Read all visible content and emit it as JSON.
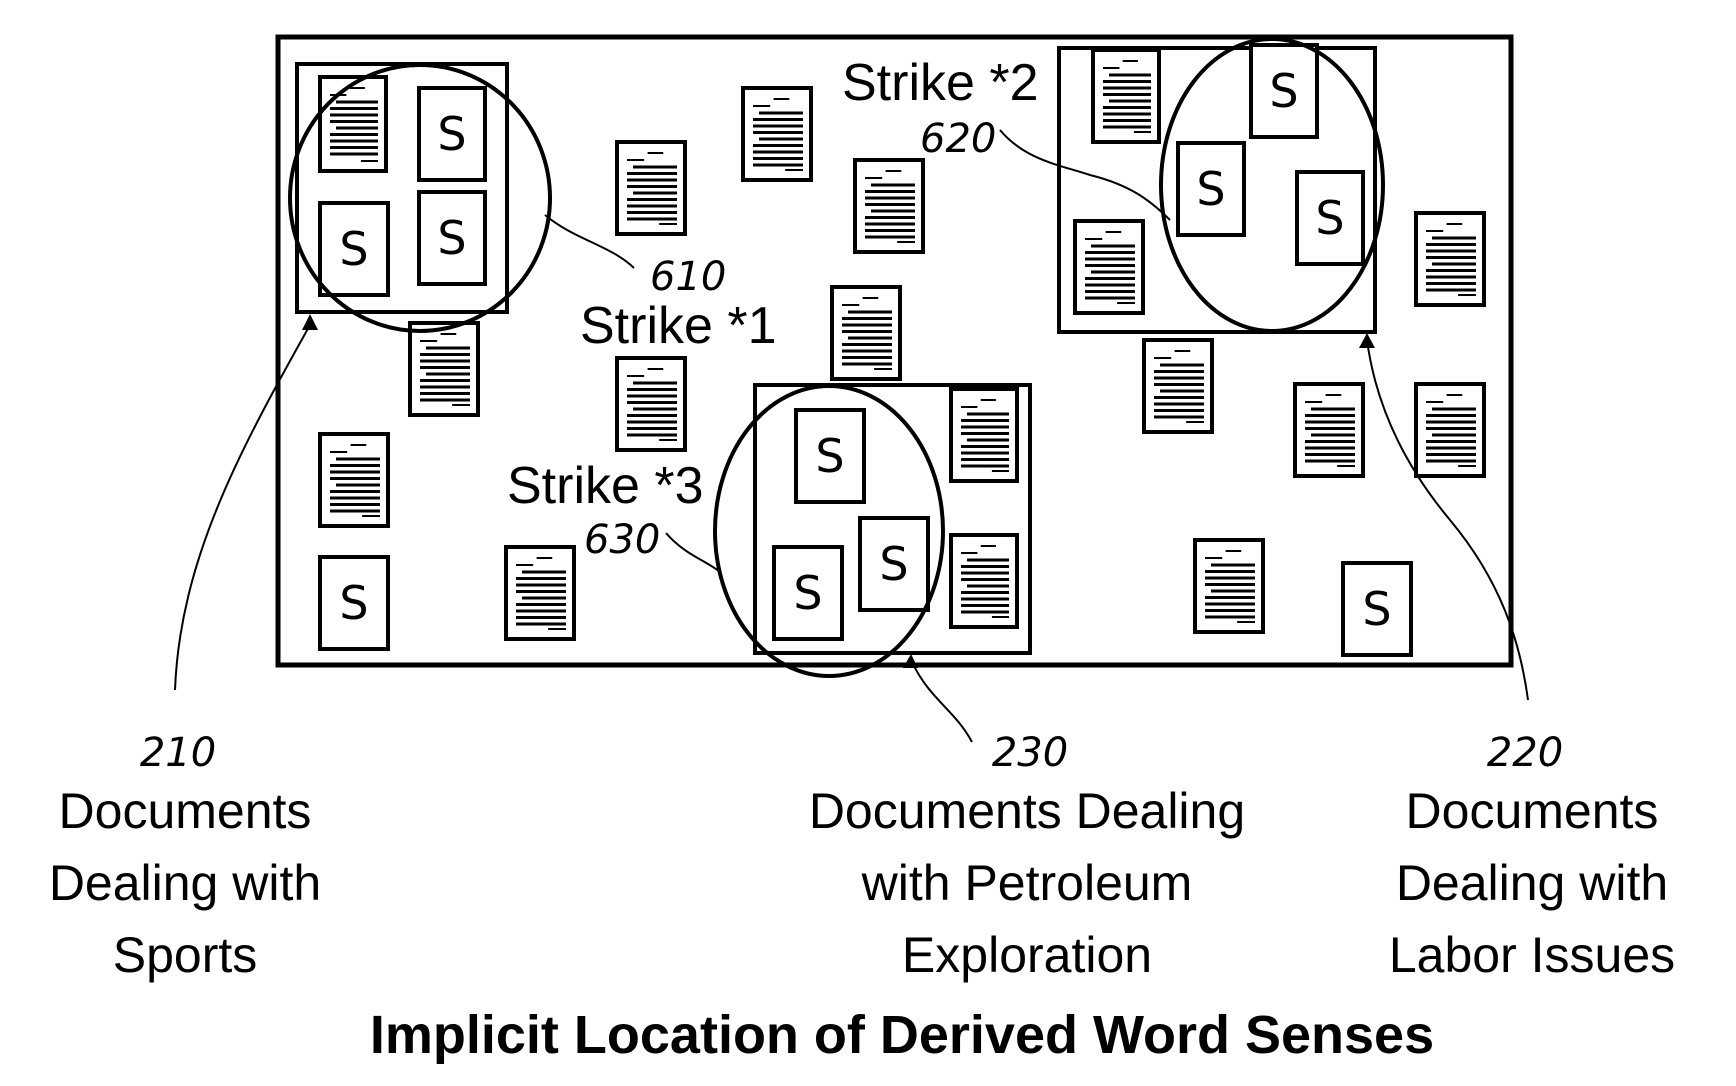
{
  "figure": {
    "title": "Implicit Location of Derived Word Senses",
    "foreground_color": "#000000",
    "background_color": "#ffffff"
  },
  "sense_labels": [
    {
      "id": "strike-1",
      "label": "Strike *1",
      "ref": "610"
    },
    {
      "id": "strike-2",
      "label": "Strike *2",
      "ref": "620"
    },
    {
      "id": "strike-3",
      "label": "Strike *3",
      "ref": "630"
    }
  ],
  "document_groups": [
    {
      "id": "sports",
      "ref": "210",
      "lines": [
        "Documents",
        "Dealing with",
        "Sports"
      ]
    },
    {
      "id": "labor",
      "ref": "220",
      "lines": [
        "Documents",
        "Dealing with",
        "Labor Issues"
      ]
    },
    {
      "id": "petroleum",
      "ref": "230",
      "lines": [
        "Documents Dealing",
        "with Petroleum",
        "Exploration"
      ]
    }
  ],
  "icons": {
    "document": "document-icon",
    "strike_document": "s-document-icon",
    "strike_document_letter": "S"
  }
}
